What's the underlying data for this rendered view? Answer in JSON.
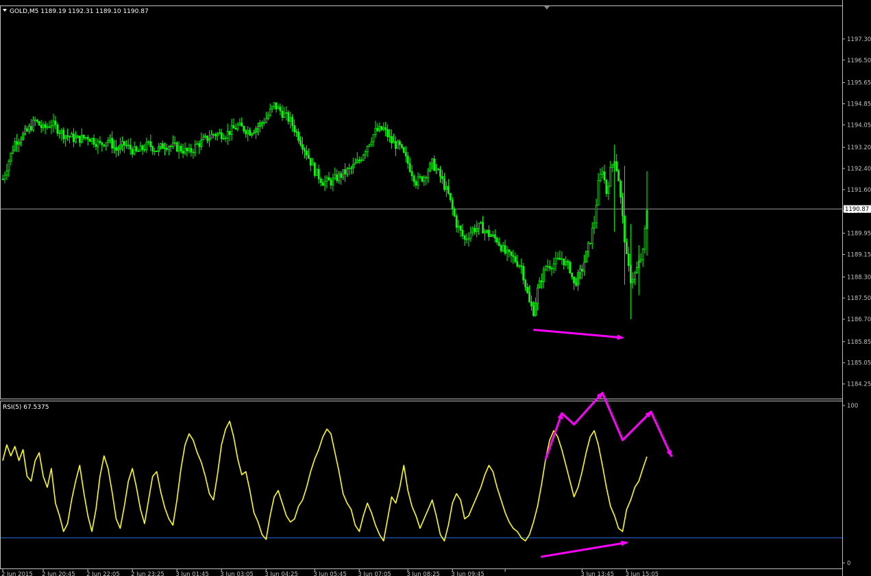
{
  "colors": {
    "background": "#000000",
    "bull_candle": "#00ff00",
    "bear_candle": "#00ff00",
    "rsi_line": "#ffff00",
    "rsi_level_line": "#2b63d6",
    "annotation": "#ff00ff",
    "grid_text": "#c0c0c0",
    "frame": "#c0c0c0",
    "price_badge_bg": "#ffffff",
    "price_badge_text": "#000000"
  },
  "price_panel": {
    "label": "GOLD,M5  1189.19 1192.31 1189.10 1190.87",
    "current_price": "1190.87",
    "current_price_value": 1190.87,
    "y_range": [
      1183.8,
      1198.1
    ],
    "y_ticks": [
      "1197.30",
      "1196.50",
      "1195.65",
      "1194.85",
      "1194.05",
      "1193.20",
      "1192.40",
      "1191.60",
      "1190.80",
      "1189.95",
      "1189.15",
      "1188.30",
      "1187.50",
      "1186.70",
      "1185.85",
      "1185.05",
      "1184.25"
    ]
  },
  "rsi_panel": {
    "label": "RSI(5) 67.5375",
    "y_range": [
      0,
      100
    ],
    "y_ticks": [
      "100",
      "0"
    ],
    "level": 16
  },
  "time_axis": {
    "labels": [
      "2 Jun 2015",
      "2 Jun 20:45",
      "2 Jun 22:05",
      "2 Jun 23:25",
      "3 Jun 01:45",
      "3 Jun 03:05",
      "3 Jun 04:25",
      "3 Jun 05:45",
      "3 Jun 07:05",
      "3 Jun 08:25",
      "3 Jun 09:45",
      "",
      "3 Jun 13:45",
      "3 Jun 15:05"
    ],
    "label_positions": [
      0,
      10,
      21,
      32,
      43,
      54,
      65,
      77,
      88,
      100,
      111,
      124,
      143,
      154
    ]
  },
  "chart_data": {
    "type": "candlestick",
    "symbol": "GOLD",
    "timeframe": "M5",
    "x_index_range": [
      0,
      159
    ],
    "price_key": [
      [
        0,
        1192.0
      ],
      [
        3,
        1193.4
      ],
      [
        6,
        1193.8
      ],
      [
        8,
        1194.2
      ],
      [
        10,
        1193.9
      ],
      [
        12,
        1194.1
      ],
      [
        15,
        1193.7
      ],
      [
        18,
        1193.5
      ],
      [
        21,
        1193.6
      ],
      [
        24,
        1193.3
      ],
      [
        26,
        1193.5
      ],
      [
        28,
        1193.1
      ],
      [
        30,
        1193.3
      ],
      [
        33,
        1193.0
      ],
      [
        36,
        1193.3
      ],
      [
        38,
        1193.1
      ],
      [
        40,
        1193.3
      ],
      [
        43,
        1193.2
      ],
      [
        46,
        1193.0
      ],
      [
        48,
        1193.3
      ],
      [
        50,
        1193.5
      ],
      [
        52,
        1193.7
      ],
      [
        55,
        1193.7
      ],
      [
        58,
        1194.0
      ],
      [
        61,
        1193.8
      ],
      [
        63,
        1194.0
      ],
      [
        65,
        1194.3
      ],
      [
        67,
        1194.8
      ],
      [
        69,
        1194.5
      ],
      [
        71,
        1194.2
      ],
      [
        73,
        1193.6
      ],
      [
        75,
        1193.0
      ],
      [
        77,
        1192.3
      ],
      [
        79,
        1191.9
      ],
      [
        81,
        1191.9
      ],
      [
        84,
        1192.2
      ],
      [
        86,
        1192.4
      ],
      [
        88,
        1192.7
      ],
      [
        90,
        1193.3
      ],
      [
        92,
        1193.8
      ],
      [
        94,
        1193.9
      ],
      [
        96,
        1193.4
      ],
      [
        98,
        1193.2
      ],
      [
        100,
        1192.6
      ],
      [
        102,
        1191.9
      ],
      [
        104,
        1192.1
      ],
      [
        106,
        1192.6
      ],
      [
        108,
        1192.1
      ],
      [
        110,
        1191.4
      ],
      [
        112,
        1190.3
      ],
      [
        114,
        1189.7
      ],
      [
        116,
        1190.1
      ],
      [
        118,
        1190.2
      ],
      [
        120,
        1189.9
      ],
      [
        122,
        1189.7
      ],
      [
        124,
        1189.2
      ],
      [
        126,
        1189.0
      ],
      [
        128,
        1188.7
      ],
      [
        129,
        1188.0
      ],
      [
        130,
        1187.3
      ],
      [
        131,
        1187.0
      ],
      [
        132,
        1187.8
      ],
      [
        134,
        1188.7
      ],
      [
        136,
        1188.8
      ],
      [
        138,
        1189.0
      ],
      [
        140,
        1188.6
      ],
      [
        141,
        1188.0
      ],
      [
        143,
        1188.6
      ],
      [
        145,
        1189.7
      ],
      [
        146,
        1190.4
      ],
      [
        147,
        1191.8
      ],
      [
        148,
        1192.4
      ],
      [
        149,
        1191.5
      ],
      [
        150,
        1192.3
      ],
      [
        151,
        1192.8
      ],
      [
        152,
        1192.0
      ],
      [
        153,
        1190.5
      ],
      [
        154,
        1189.0
      ],
      [
        155,
        1188.2
      ],
      [
        156,
        1188.4
      ],
      [
        157,
        1188.8
      ],
      [
        158,
        1189.2
      ],
      [
        159,
        1190.87
      ]
    ],
    "rsi_key": [
      [
        0,
        65
      ],
      [
        1,
        75
      ],
      [
        2,
        68
      ],
      [
        3,
        74
      ],
      [
        4,
        65
      ],
      [
        5,
        72
      ],
      [
        6,
        55
      ],
      [
        7,
        52
      ],
      [
        8,
        65
      ],
      [
        9,
        70
      ],
      [
        10,
        55
      ],
      [
        11,
        48
      ],
      [
        12,
        60
      ],
      [
        13,
        38
      ],
      [
        14,
        30
      ],
      [
        15,
        20
      ],
      [
        16,
        25
      ],
      [
        17,
        40
      ],
      [
        18,
        52
      ],
      [
        19,
        62
      ],
      [
        20,
        45
      ],
      [
        21,
        30
      ],
      [
        22,
        20
      ],
      [
        23,
        34
      ],
      [
        24,
        55
      ],
      [
        25,
        68
      ],
      [
        26,
        60
      ],
      [
        27,
        45
      ],
      [
        28,
        28
      ],
      [
        29,
        22
      ],
      [
        30,
        36
      ],
      [
        31,
        52
      ],
      [
        32,
        60
      ],
      [
        33,
        48
      ],
      [
        34,
        34
      ],
      [
        35,
        25
      ],
      [
        36,
        40
      ],
      [
        37,
        55
      ],
      [
        38,
        58
      ],
      [
        39,
        45
      ],
      [
        40,
        35
      ],
      [
        41,
        28
      ],
      [
        42,
        24
      ],
      [
        43,
        40
      ],
      [
        44,
        60
      ],
      [
        45,
        75
      ],
      [
        46,
        82
      ],
      [
        47,
        78
      ],
      [
        48,
        70
      ],
      [
        49,
        64
      ],
      [
        50,
        55
      ],
      [
        51,
        44
      ],
      [
        52,
        40
      ],
      [
        53,
        56
      ],
      [
        54,
        75
      ],
      [
        55,
        85
      ],
      [
        56,
        90
      ],
      [
        57,
        80
      ],
      [
        58,
        66
      ],
      [
        59,
        56
      ],
      [
        60,
        58
      ],
      [
        61,
        46
      ],
      [
        62,
        32
      ],
      [
        63,
        26
      ],
      [
        64,
        18
      ],
      [
        65,
        15
      ],
      [
        66,
        30
      ],
      [
        67,
        42
      ],
      [
        68,
        46
      ],
      [
        69,
        38
      ],
      [
        70,
        30
      ],
      [
        71,
        26
      ],
      [
        72,
        28
      ],
      [
        73,
        36
      ],
      [
        74,
        40
      ],
      [
        75,
        48
      ],
      [
        76,
        58
      ],
      [
        77,
        66
      ],
      [
        78,
        72
      ],
      [
        79,
        80
      ],
      [
        80,
        85
      ],
      [
        81,
        82
      ],
      [
        82,
        70
      ],
      [
        83,
        58
      ],
      [
        84,
        44
      ],
      [
        85,
        38
      ],
      [
        86,
        34
      ],
      [
        87,
        24
      ],
      [
        88,
        20
      ],
      [
        89,
        30
      ],
      [
        90,
        38
      ],
      [
        91,
        32
      ],
      [
        92,
        24
      ],
      [
        93,
        18
      ],
      [
        94,
        14
      ],
      [
        95,
        28
      ],
      [
        96,
        42
      ],
      [
        97,
        38
      ],
      [
        98,
        48
      ],
      [
        99,
        62
      ],
      [
        100,
        46
      ],
      [
        101,
        36
      ],
      [
        102,
        30
      ],
      [
        103,
        22
      ],
      [
        104,
        28
      ],
      [
        105,
        34
      ],
      [
        106,
        40
      ],
      [
        107,
        30
      ],
      [
        108,
        18
      ],
      [
        109,
        14
      ],
      [
        110,
        24
      ],
      [
        111,
        38
      ],
      [
        112,
        44
      ],
      [
        113,
        40
      ],
      [
        114,
        28
      ],
      [
        115,
        30
      ],
      [
        116,
        36
      ],
      [
        117,
        42
      ],
      [
        118,
        48
      ],
      [
        119,
        56
      ],
      [
        120,
        62
      ],
      [
        121,
        58
      ],
      [
        122,
        48
      ],
      [
        123,
        40
      ],
      [
        124,
        32
      ],
      [
        125,
        26
      ],
      [
        126,
        22
      ],
      [
        127,
        20
      ],
      [
        128,
        16
      ],
      [
        129,
        14
      ],
      [
        130,
        18
      ],
      [
        131,
        26
      ],
      [
        132,
        36
      ],
      [
        133,
        50
      ],
      [
        134,
        66
      ],
      [
        135,
        78
      ],
      [
        136,
        84
      ],
      [
        137,
        80
      ],
      [
        138,
        72
      ],
      [
        139,
        62
      ],
      [
        140,
        52
      ],
      [
        141,
        42
      ],
      [
        142,
        48
      ],
      [
        143,
        58
      ],
      [
        144,
        70
      ],
      [
        145,
        80
      ],
      [
        146,
        84
      ],
      [
        147,
        75
      ],
      [
        148,
        62
      ],
      [
        149,
        48
      ],
      [
        150,
        36
      ],
      [
        151,
        30
      ],
      [
        152,
        22
      ],
      [
        153,
        20
      ],
      [
        154,
        34
      ],
      [
        155,
        40
      ],
      [
        156,
        48
      ],
      [
        157,
        52
      ],
      [
        158,
        60
      ],
      [
        159,
        67.54
      ]
    ],
    "arrows_price": [
      {
        "from": [
          131,
          1186.3
        ],
        "to": [
          153,
          1186.0
        ]
      }
    ],
    "arrows_rsi": [
      {
        "from": [
          134,
          66
        ],
        "to": [
          138,
          95
        ]
      },
      {
        "from": [
          138,
          95
        ],
        "to": [
          141,
          88
        ]
      },
      {
        "from": [
          141,
          88
        ],
        "to": [
          148,
          108
        ]
      },
      {
        "from": [
          148,
          108
        ],
        "to": [
          153,
          78
        ]
      },
      {
        "from": [
          153,
          78
        ],
        "to": [
          160,
          96
        ]
      },
      {
        "from": [
          160,
          96
        ],
        "to": [
          165,
          68
        ]
      },
      {
        "from": [
          133,
          4
        ],
        "to": [
          154,
          13
        ]
      }
    ]
  }
}
